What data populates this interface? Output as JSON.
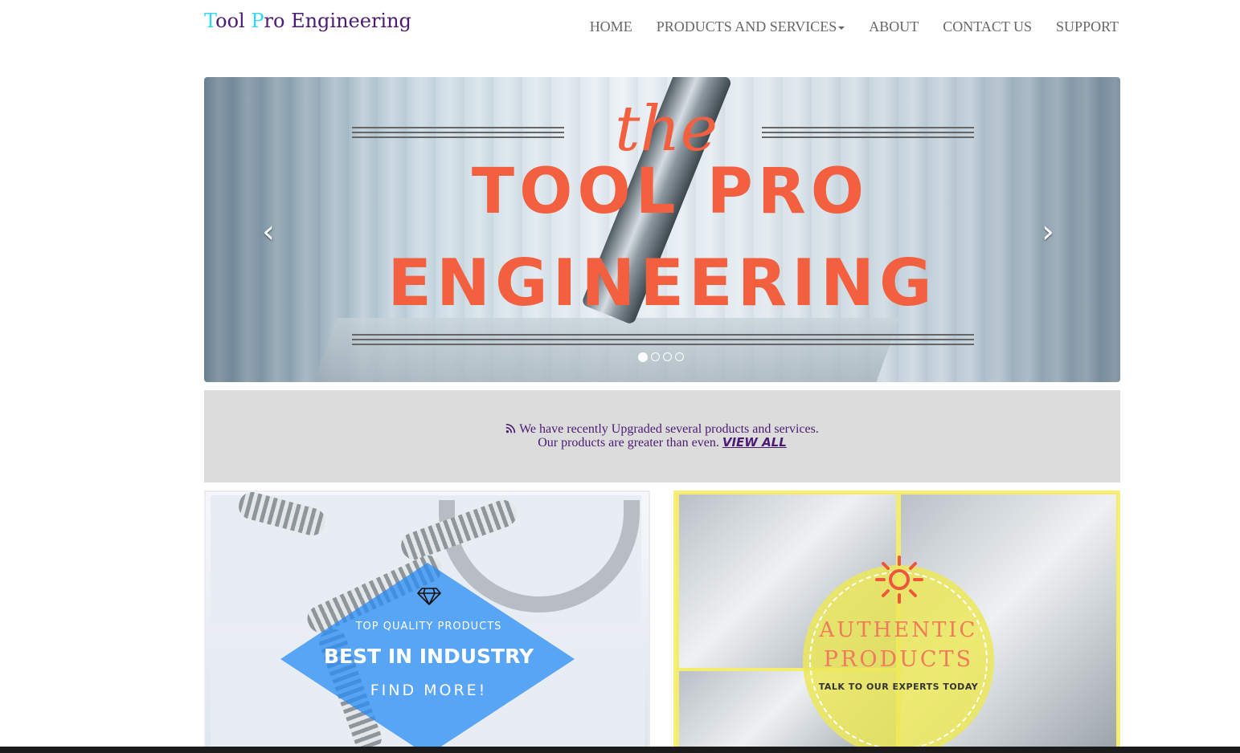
{
  "brand": {
    "part1_accent": "T",
    "part1_rest": "ool ",
    "part2_accent": "P",
    "part2_rest": "ro Engineering"
  },
  "nav": {
    "home": "HOME",
    "products": "PRODUCTS AND SERVICES",
    "about": "ABOUT",
    "contact": "CONTACT US",
    "support": "SUPPORT"
  },
  "carousel": {
    "line_the": "the",
    "line1": "TOOL PRO",
    "line2": "ENGINEERING",
    "prev": "‹",
    "next": "›",
    "slides_count": 4,
    "active_slide": 1,
    "title_color": "#f2603f"
  },
  "news": {
    "line1": "We have recently Upgraded several products and services.",
    "line2": "Our products are greater than even.",
    "link": "VIEW ALL",
    "text_color": "#4b1a72"
  },
  "tile_left": {
    "kicker": "TOP QUALITY PRODUCTS",
    "headline": "BEST IN INDUSTRY",
    "cta": "FIND MORE!",
    "icon": "diamond-icon"
  },
  "tile_right": {
    "line1": "AUTHENTIC",
    "line2": "PRODUCTS",
    "cta": "TALK TO OUR EXPERTS TODAY",
    "icon": "sun-icon"
  },
  "colors": {
    "accent_cyan": "#33d6f0",
    "brand_purple": "#4b1a72",
    "banner_orange": "#f2603f",
    "tile_blue": "#288cf5",
    "tile_yellow": "#f3ec6e"
  }
}
